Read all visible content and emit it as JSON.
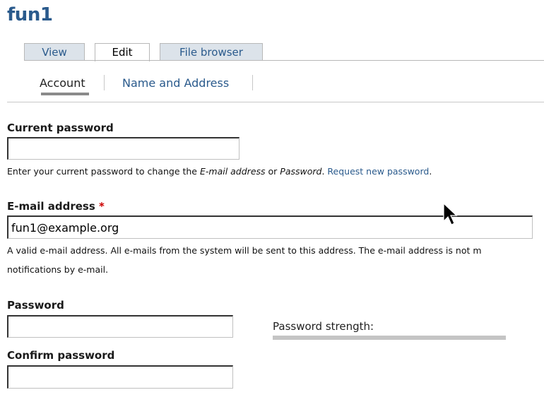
{
  "page": {
    "title": "fun1"
  },
  "primary_tabs": {
    "view": "View",
    "edit": "Edit",
    "file_browser": "File browser",
    "active": "Edit"
  },
  "secondary_tabs": {
    "account": "Account",
    "name_address": "Name and Address",
    "active": "Account"
  },
  "current_password": {
    "label": "Current password",
    "value": "",
    "desc_prefix": "Enter your current password to change the ",
    "desc_em1": "E-mail address",
    "desc_mid": " or ",
    "desc_em2": "Password",
    "desc_suffix": ". ",
    "link": "Request new password",
    "desc_end": "."
  },
  "email": {
    "label": "E-mail address",
    "required_marker": "*",
    "value": "fun1@example.org",
    "desc_line1": "A valid e-mail address. All e-mails from the system will be sent to this address. The e-mail address is not m",
    "desc_line2": "notifications by e-mail."
  },
  "password": {
    "label": "Password",
    "value": "",
    "strength_label": "Password strength:"
  },
  "confirm_password": {
    "label": "Confirm password",
    "value": ""
  },
  "colors": {
    "link": "#2a5a8c",
    "tab_bg": "#dce3ea",
    "required": "#cc0000"
  }
}
